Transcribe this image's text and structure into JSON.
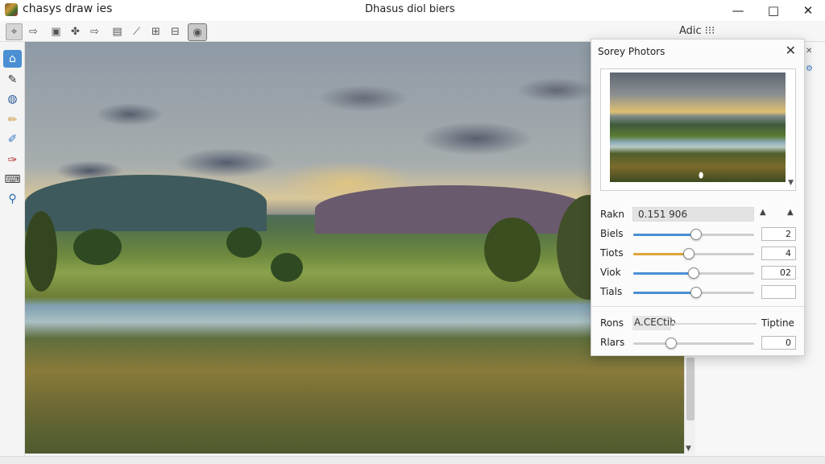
{
  "titlebar": {
    "app_name": "chasys draw ies",
    "document_title": "Dhasus diol biers",
    "minimize": "—",
    "maximize": "□",
    "close": "✕"
  },
  "toolbar": {
    "right_label": "Adic ⁝⁝⁝"
  },
  "right_panel": {
    "mini_close": "✕",
    "mini_icon": "⚙"
  },
  "dialog": {
    "title": "Sorey Photors",
    "close": "✕",
    "rakn": {
      "label": "Rakn",
      "value": "0.151 906",
      "up1": "▲",
      "up2": "▲"
    },
    "sliders": [
      {
        "label": "Biels",
        "value": "2",
        "level": 0.52,
        "color": "#4a8fd4"
      },
      {
        "label": "Tiots",
        "value": "4",
        "level": 0.46,
        "color": "#e0a53a"
      },
      {
        "label": "Viok",
        "value": "02",
        "level": 0.5,
        "color": "#4a8fd4"
      },
      {
        "label": "Tials",
        "value": "",
        "level": 0.52,
        "color": "#4a8fd4"
      }
    ],
    "rons": {
      "label": "Rons",
      "value": "A.CECtib",
      "right": "Tiptine"
    },
    "rlars": {
      "label": "Rlars",
      "value": "0",
      "level": 0.31
    }
  }
}
